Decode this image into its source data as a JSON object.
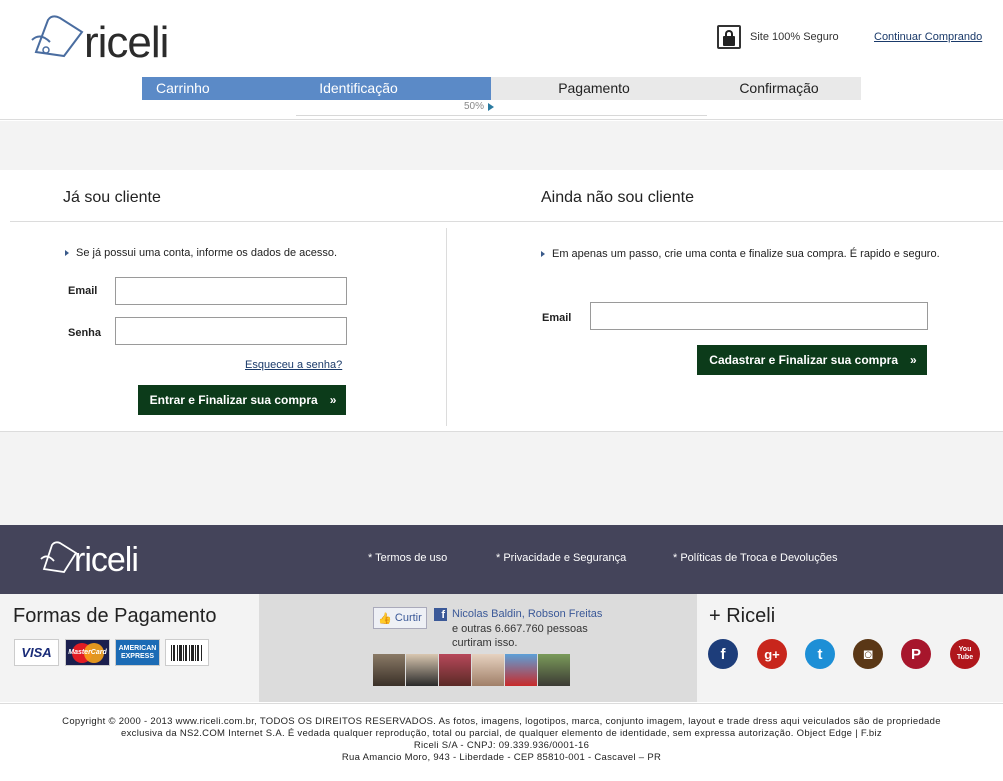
{
  "header": {
    "logo_text": "riceli",
    "secure_text": "Site 100% Seguro",
    "continue_label": "Continuar Comprando"
  },
  "steps": [
    {
      "label": "Carrinho",
      "active": true
    },
    {
      "label": "Identificação",
      "active": true
    },
    {
      "label": "Pagamento",
      "active": false
    },
    {
      "label": "Confirmação",
      "active": false
    }
  ],
  "progress": {
    "label": "50%",
    "value": 0.5
  },
  "existing": {
    "title": "Já sou cliente",
    "hint": "Se já possui uma conta, informe os dados de acesso.",
    "email_label": "Email",
    "password_label": "Senha",
    "email_value": "",
    "password_value": "",
    "forgot_label": "Esqueceu a senha?",
    "submit_label": "Entrar e Finalizar sua compra",
    "submit_icon": "»"
  },
  "new_customer": {
    "title": "Ainda não sou cliente",
    "hint": "Em apenas um passo, crie uma conta e finalize sua compra. É rapido e seguro.",
    "email_label": "Email",
    "email_value": "",
    "submit_label": "Cadastrar e Finalizar sua compra",
    "submit_icon": "»"
  },
  "footer": {
    "logo_text": "riceli",
    "links": [
      "* Termos de uso",
      "* Privacidade e Segurança",
      "* Políticas de Troca e Devoluções"
    ],
    "payment_title": "Formas de Pagamento",
    "cards": [
      "VISA",
      "MasterCard",
      "AMERICAN EXPRESS",
      "boleto"
    ],
    "facebook": {
      "like_label": "Curtir",
      "name1": "Nicolas Baldin",
      "separator": ", ",
      "name2": "Robson Freitas",
      "others_text": "e outras 6.667.760 pessoas curtiram isso."
    },
    "social_title": "+ Riceli",
    "social": [
      {
        "icon": "facebook-icon",
        "glyph": "f",
        "color": "#1d3d7a"
      },
      {
        "icon": "google-plus-icon",
        "glyph": "g+",
        "color": "#c8261c"
      },
      {
        "icon": "twitter-icon",
        "glyph": "t",
        "color": "#1d8fd6"
      },
      {
        "icon": "instagram-icon",
        "glyph": "◙",
        "color": "#5a3716"
      },
      {
        "icon": "pinterest-icon",
        "glyph": "P",
        "color": "#a7162c"
      },
      {
        "icon": "youtube-icon",
        "glyph": "You Tube",
        "color": "#b0171c"
      }
    ],
    "copyright": [
      "Copyright © 2000 - 2013 www.riceli.com.br, TODOS OS DIREITOS RESERVADOS. As fotos, imagens, logotipos, marca, conjunto imagem, layout e trade dress aqui veiculados são de propriedade",
      "exclusiva da NS2.COM Internet S.A. É vedada qualquer reprodução, total ou parcial, de qualquer elemento de identidade, sem expressa autorização. Object Edge | F.biz",
      "Riceli S/A - CNPJ: 09.339.936/0001-16",
      "Rua Amancio Moro, 943 - Liberdade - CEP 85810-001 - Cascavel – PR"
    ]
  }
}
